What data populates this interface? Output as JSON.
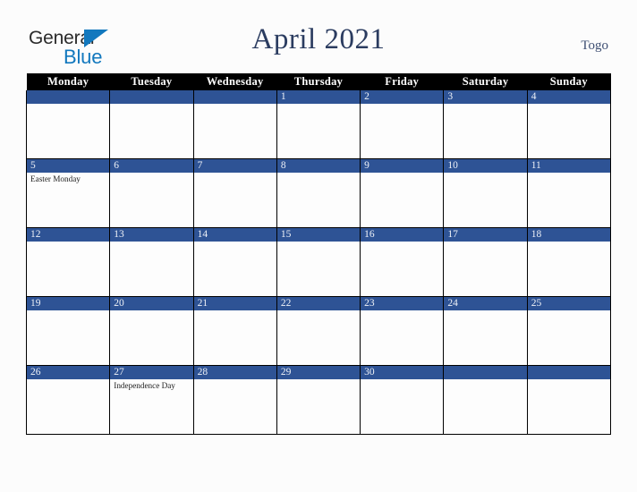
{
  "brand": {
    "logo_general": "General",
    "logo_blue": "Blue",
    "triangle_icon": "blue-triangle-icon",
    "colors": {
      "general_text": "#2b2b2b",
      "blue_text": "#1278be",
      "triangle": "#1278be"
    }
  },
  "header": {
    "title": "April 2021",
    "region": "Togo",
    "title_color": "#2b3c60",
    "region_color": "#3d4e72"
  },
  "calendar": {
    "month": "April",
    "year": "2021",
    "weekday_headers": [
      "Monday",
      "Tuesday",
      "Wednesday",
      "Thursday",
      "Friday",
      "Saturday",
      "Sunday"
    ],
    "header_bg": "#000000",
    "header_text_color": "#ffffff",
    "daynum_bg": "#2e5395",
    "daynum_text_color": "#eef1f7",
    "cell_bg": "#fdfdfd",
    "grid_line_color": "#000000",
    "weeks": [
      [
        {
          "day": "",
          "events": []
        },
        {
          "day": "",
          "events": []
        },
        {
          "day": "",
          "events": []
        },
        {
          "day": "1",
          "events": []
        },
        {
          "day": "2",
          "events": []
        },
        {
          "day": "3",
          "events": []
        },
        {
          "day": "4",
          "events": []
        }
      ],
      [
        {
          "day": "5",
          "events": [
            "Easter Monday"
          ]
        },
        {
          "day": "6",
          "events": []
        },
        {
          "day": "7",
          "events": []
        },
        {
          "day": "8",
          "events": []
        },
        {
          "day": "9",
          "events": []
        },
        {
          "day": "10",
          "events": []
        },
        {
          "day": "11",
          "events": []
        }
      ],
      [
        {
          "day": "12",
          "events": []
        },
        {
          "day": "13",
          "events": []
        },
        {
          "day": "14",
          "events": []
        },
        {
          "day": "15",
          "events": []
        },
        {
          "day": "16",
          "events": []
        },
        {
          "day": "17",
          "events": []
        },
        {
          "day": "18",
          "events": []
        }
      ],
      [
        {
          "day": "19",
          "events": []
        },
        {
          "day": "20",
          "events": []
        },
        {
          "day": "21",
          "events": []
        },
        {
          "day": "22",
          "events": []
        },
        {
          "day": "23",
          "events": []
        },
        {
          "day": "24",
          "events": []
        },
        {
          "day": "25",
          "events": []
        }
      ],
      [
        {
          "day": "26",
          "events": []
        },
        {
          "day": "27",
          "events": [
            "Independence Day"
          ]
        },
        {
          "day": "28",
          "events": []
        },
        {
          "day": "29",
          "events": []
        },
        {
          "day": "30",
          "events": []
        },
        {
          "day": "",
          "events": []
        },
        {
          "day": "",
          "events": []
        }
      ]
    ]
  }
}
